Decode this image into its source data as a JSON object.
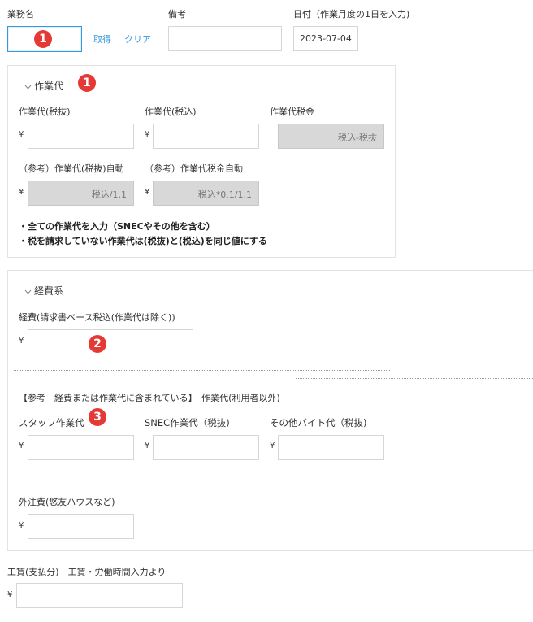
{
  "top": {
    "business_name_label": "業務名",
    "business_name_marker": "1",
    "fetch_link": "取得",
    "clear_link": "クリア",
    "remarks_label": "備考",
    "date_label": "日付（作業月度の1日を入力)",
    "date_value": "2023-07-04"
  },
  "work_fee": {
    "title": "作業代",
    "marker": "1",
    "excl_label": "作業代(税抜)",
    "incl_label": "作業代(税込)",
    "tax_label": "作業代税金",
    "tax_placeholder": "税込-税抜",
    "ref_excl_label": "（参考）作業代(税抜)自動",
    "ref_excl_placeholder": "税込/1.1",
    "ref_tax_label": "（参考）作業代税金自動",
    "ref_tax_placeholder": "税込*0.1/1.1",
    "note1": "・全ての作業代を入力（SNECやその他を含む）",
    "note2": "・税を請求していない作業代は(税抜)と(税込)を同じ値にする",
    "currency": "¥"
  },
  "expenses": {
    "title": "経費系",
    "expense_label": "経費(請求書ベース税込(作業代は除く))",
    "expense_marker": "2",
    "ref_heading": "【参考　経費または作業代に含まれている】　作業代(利用者以外)",
    "staff_label": "スタッフ作業代",
    "staff_marker": "3",
    "snec_label": "SNEC作業代（税抜)",
    "other_label": "その他バイト代（税抜)",
    "outsource_label": "外注費(悠友ハウスなど)",
    "currency": "¥"
  },
  "wages": {
    "label": "工賃(支払分)　工賃・労働時間入力より",
    "currency": "¥"
  },
  "colors": {
    "accent": "#3498db",
    "marker": "#e53935",
    "disabled": "#d8d8d8"
  }
}
